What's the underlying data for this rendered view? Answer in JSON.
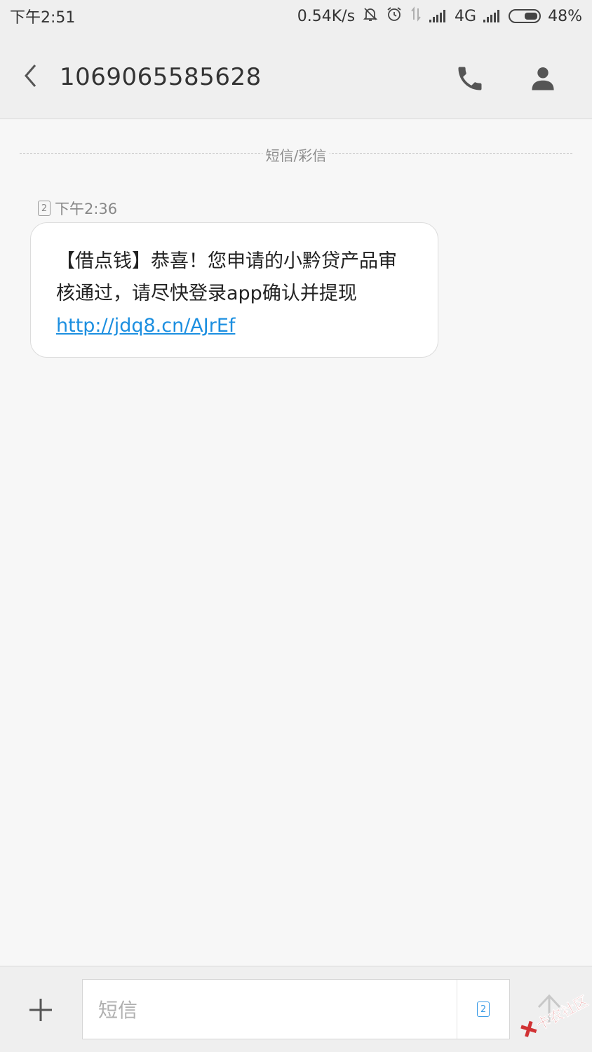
{
  "status_bar": {
    "time": "下午2:51",
    "net_speed": "0.54K/s",
    "network_type": "4G",
    "battery": "48%"
  },
  "header": {
    "title": "1069065585628",
    "back_icon": "back-chevron",
    "call_icon": "phone",
    "contact_icon": "person"
  },
  "conversation": {
    "divider_label": "短信/彩信",
    "messages": [
      {
        "sim": "2",
        "time": "下午2:36",
        "text": "【借点钱】恭喜！您申请的小黔贷产品审核通过，请尽快登录app确认并提现",
        "link": "http://jdq8.cn/AJrEf"
      }
    ]
  },
  "composer": {
    "placeholder": "短信",
    "sim": "2",
    "add_icon": "plus",
    "send_icon": "send-arrow"
  },
  "watermark": {
    "text": "卡农社区"
  },
  "colors": {
    "background": "#f7f7f7",
    "bar": "#efefef",
    "link": "#1c8fe0",
    "sim_accent": "#3a9be6",
    "watermark": "#d0282a"
  }
}
